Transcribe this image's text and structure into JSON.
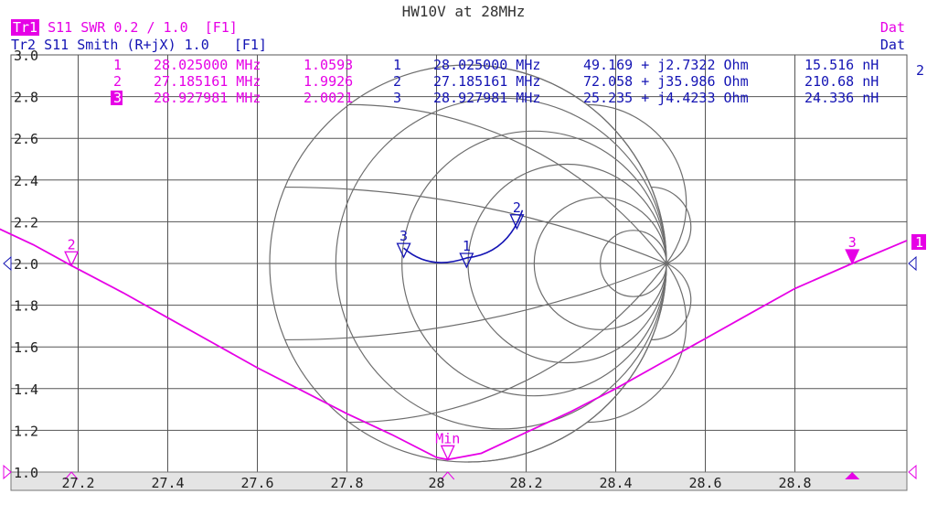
{
  "title": "HW10V at 28MHz",
  "trace1": {
    "tag": "Tr1",
    "label": "S11 SWR 0.2 / 1.0  [F1]",
    "status": "Dat",
    "color": "#e600e6"
  },
  "trace2": {
    "label": "Tr2 S11 Smith (R+jX) 1.0   [F1]",
    "status": "Dat",
    "color": "#1414b4"
  },
  "marker_table_tr1": [
    {
      "num": "1",
      "freq": "28.025000 MHz",
      "val": "1.0593"
    },
    {
      "num": "2",
      "freq": "27.185161 MHz",
      "val": "1.9926"
    },
    {
      "num": "3",
      "freq": "28.927981 MHz",
      "val": "2.0021"
    }
  ],
  "marker_table_tr2": [
    {
      "num": "1",
      "freq": "28.025000 MHz",
      "imp": "49.169 + j2.7322 Ohm",
      "ind": "15.516 nH"
    },
    {
      "num": "2",
      "freq": "27.185161 MHz",
      "imp": "72.058 + j35.986 Ohm",
      "ind": "210.68 nH"
    },
    {
      "num": "3",
      "freq": "28.927981 MHz",
      "imp": "25.235 + j4.4233 Ohm",
      "ind": "24.336 nH"
    }
  ],
  "right_labels": {
    "tr2": "2",
    "tr1": "1"
  },
  "min_label": "Min",
  "chart_data": {
    "type": "line",
    "xlim": [
      27.05,
      29.05
    ],
    "ylim": [
      1.0,
      3.0
    ],
    "yticks": [
      "3.0",
      "2.8",
      "2.6",
      "2.4",
      "2.2",
      "2.0",
      "1.8",
      "1.6",
      "1.4",
      "1.2",
      "1.0"
    ],
    "xticks": [
      "27.2",
      "27.4",
      "27.6",
      "27.8",
      "28",
      "28.2",
      "28.4",
      "28.6",
      "28.8"
    ],
    "grid": true,
    "series": [
      {
        "x": [
          26.95,
          27.0,
          27.1,
          27.185,
          27.3,
          27.4,
          27.5,
          27.6,
          27.7,
          27.8,
          27.9,
          28.0,
          28.025,
          28.1,
          28.2,
          28.3,
          28.4,
          28.5,
          28.6,
          28.7,
          28.8,
          28.928,
          29.05
        ],
        "y": [
          2.3,
          2.19,
          2.09,
          1.99,
          1.86,
          1.74,
          1.62,
          1.5,
          1.39,
          1.28,
          1.18,
          1.07,
          1.06,
          1.09,
          1.19,
          1.29,
          1.4,
          1.52,
          1.64,
          1.76,
          1.88,
          2.0,
          2.11
        ]
      }
    ],
    "markers": [
      {
        "label": "2",
        "x": 27.185,
        "y": 1.99
      },
      {
        "label": "Min",
        "x": 28.025,
        "y": 1.06
      },
      {
        "label": "3",
        "x": 28.928,
        "y": 2.0
      }
    ],
    "smith_markers": [
      {
        "label": "1",
        "r": 49.169,
        "x": 2.7322
      },
      {
        "label": "2",
        "r": 72.058,
        "x": 35.986
      },
      {
        "label": "3",
        "r": 25.235,
        "x": 4.4233
      }
    ]
  }
}
